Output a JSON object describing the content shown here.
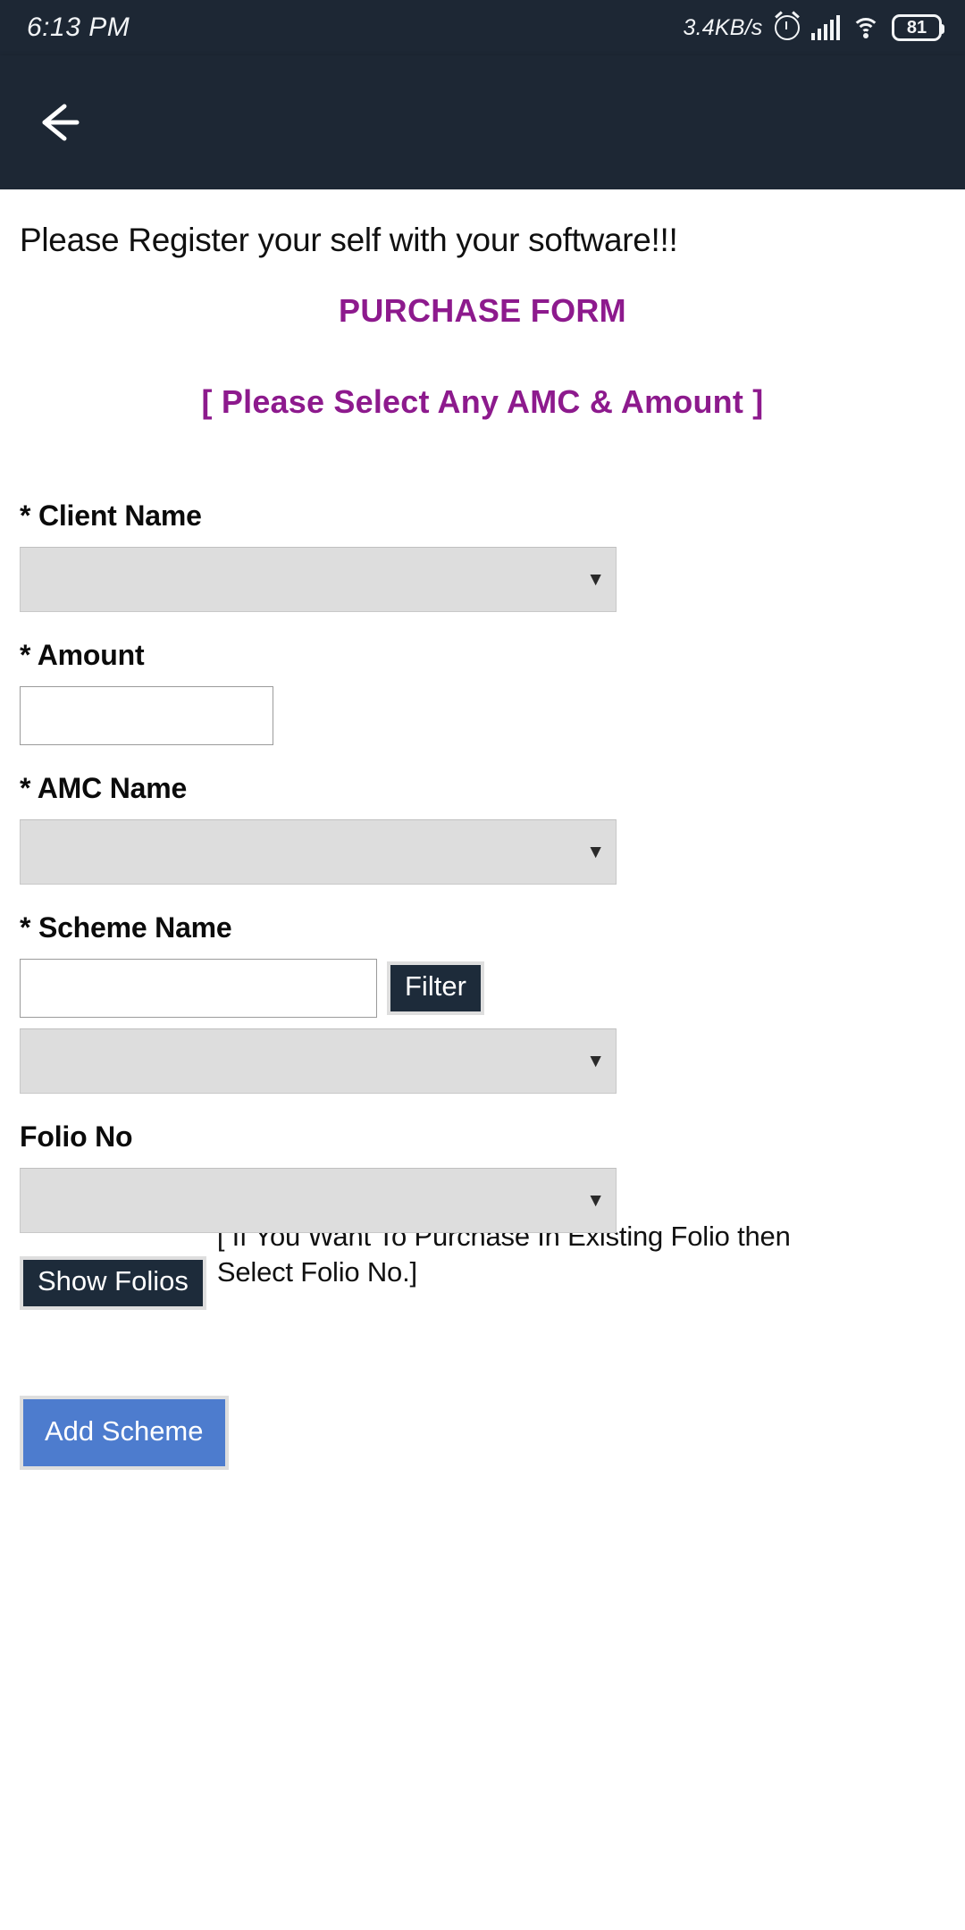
{
  "status_bar": {
    "clock": "6:13 PM",
    "net_speed": "3.4KB/s",
    "battery_level": "81",
    "icons": [
      "alarm-icon",
      "signal-icon",
      "wifi-icon",
      "battery-icon"
    ]
  },
  "app_bar": {
    "back_icon": "back-arrow-icon",
    "background_color": "#1d2734"
  },
  "page": {
    "register_note": "Please Register your self with your software!!!",
    "title": "PURCHASE FORM",
    "subtitle": "[ Please Select Any AMC & Amount ]",
    "accent_color": "#8d1a8d"
  },
  "form": {
    "client_name": {
      "label": "* Client Name",
      "value": "",
      "arrow": "▼"
    },
    "amount": {
      "label": "* Amount",
      "value": "",
      "placeholder": ""
    },
    "amc_name": {
      "label": "* AMC Name",
      "value": "",
      "arrow": "▼"
    },
    "scheme_name": {
      "label": "* Scheme Name",
      "filter_value": "",
      "filter_placeholder": "",
      "filter_button": "Filter",
      "value": "",
      "arrow": "▼"
    },
    "folio_no": {
      "label": "Folio No",
      "value": "",
      "arrow": "▼",
      "show_folios_button": "Show Folios",
      "hint": "[ If You Want To Purchase In Existing Folio then Select Folio No.]"
    },
    "add_scheme_button": "Add Scheme",
    "button_colors": {
      "dark": "#1d2b3a",
      "blue": "#4d7cce"
    }
  }
}
